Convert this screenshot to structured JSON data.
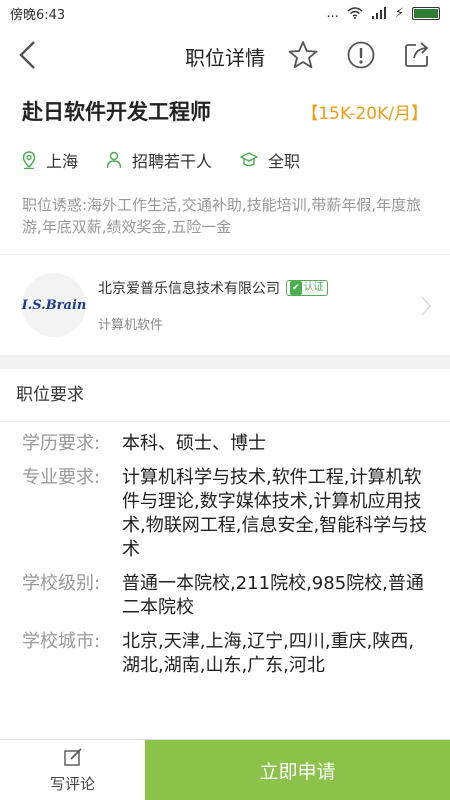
{
  "status": {
    "time": "傍晚6:43",
    "dots": "...",
    "bolt": "⚡"
  },
  "header": {
    "title": "职位详情"
  },
  "job": {
    "title": "赴日软件开发工程师",
    "salary": "【15K-20K/月】",
    "location": "上海",
    "headcount": "招聘若干人",
    "type": "全职",
    "perks": "职位诱惑:海外工作生活,交通补助,技能培训,带薪年假,年度旅游,年底双薪,绩效奖金,五险一金"
  },
  "company": {
    "logo_text": "I.S.Brain",
    "name": "北京爱普乐信息技术有限公司",
    "verified_label": "认证",
    "industry": "计算机软件"
  },
  "requirements": {
    "header": "职位要求",
    "items": [
      {
        "label": "学历要求:",
        "value": "本科、硕士、博士"
      },
      {
        "label": "专业要求:",
        "value": "计算机科学与技术,软件工程,计算机软件与理论,数字媒体技术,计算机应用技术,物联网工程,信息安全,智能科学与技术"
      },
      {
        "label": "学校级别:",
        "value": "普通一本院校,211院校,985院校,普通二本院校"
      },
      {
        "label": "学校城市:",
        "value": "北京,天津,上海,辽宁,四川,重庆,陕西,湖北,湖南,山东,广东,河北"
      }
    ]
  },
  "bottom": {
    "comment_label": "写评论",
    "apply_label": "立即申请"
  },
  "colors": {
    "accent_green": "#8bc34a",
    "salary_orange": "#f39c12",
    "icon_green": "#4caf50"
  }
}
